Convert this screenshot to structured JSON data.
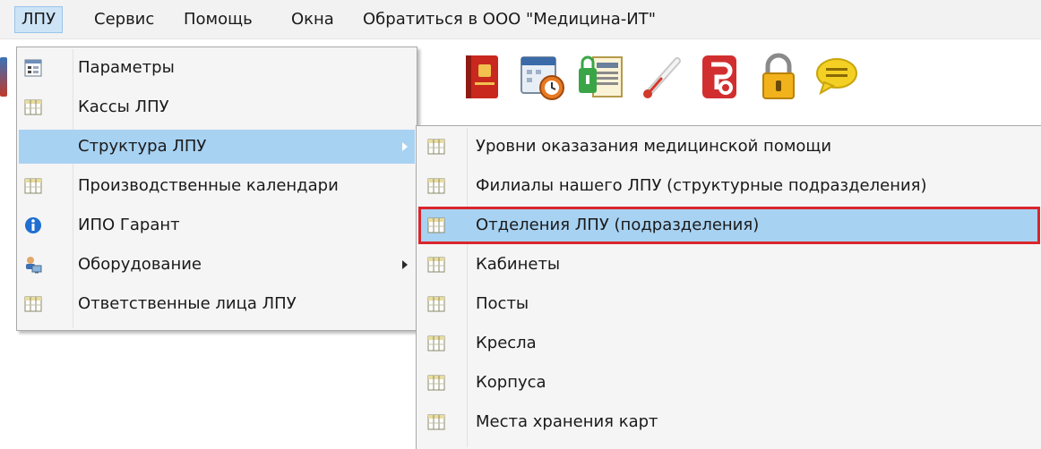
{
  "menubar": {
    "items": [
      {
        "label": "ЛПУ",
        "active": true
      },
      {
        "label": "Сервис"
      },
      {
        "label": "Помощь"
      },
      {
        "label": "Окна"
      },
      {
        "label": "Обратиться в ООО \"Медицина-ИТ\""
      }
    ]
  },
  "toolbar": {
    "icons": [
      "red-book-icon",
      "calendar-clock-icon",
      "lock-document-icon",
      "thermometer-icon",
      "red-document-icon",
      "padlock-icon",
      "speech-bubble-icon"
    ]
  },
  "lpu_menu": {
    "items": [
      {
        "label": "Параметры",
        "icon": "parameters-icon"
      },
      {
        "label": "Кассы ЛПУ",
        "icon": "table-icon"
      },
      {
        "label": "Структура ЛПУ",
        "icon": "",
        "submenu": true,
        "highlighted": true
      },
      {
        "label": "Производственные календари",
        "icon": "table-icon"
      },
      {
        "label": "ИПО Гарант",
        "icon": "info-icon"
      },
      {
        "label": "Оборудование",
        "icon": "equipment-icon",
        "submenu": true
      },
      {
        "label": "Ответственные лица ЛПУ",
        "icon": "table-icon"
      }
    ]
  },
  "structure_submenu": {
    "items": [
      {
        "label": "Уровни оказазания медицинской помощи",
        "icon": "table-icon"
      },
      {
        "label": "Филиалы нашего ЛПУ (структурные подразделения)",
        "icon": "table-icon"
      },
      {
        "label": "Отделения ЛПУ (подразделения)",
        "icon": "table-icon",
        "selected": true
      },
      {
        "label": "Кабинеты",
        "icon": "table-icon"
      },
      {
        "label": "Посты",
        "icon": "table-icon"
      },
      {
        "label": "Кресла",
        "icon": "table-icon"
      },
      {
        "label": "Корпуса",
        "icon": "table-icon"
      },
      {
        "label": "Места хранения карт",
        "icon": "table-icon"
      }
    ]
  },
  "colors": {
    "menu_highlight": "#a8d2f2",
    "selection_outline": "#d9262c",
    "menubar_active": "#cde4f7"
  }
}
